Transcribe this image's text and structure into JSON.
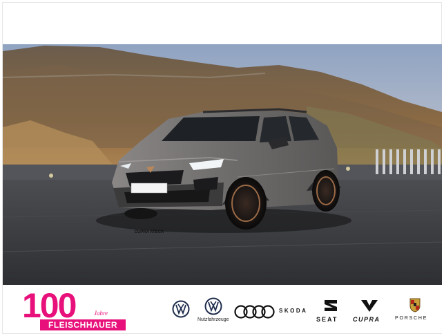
{
  "hero": {
    "plate_text": "CUPRA ATECA",
    "car_color": "#6f6d6c",
    "sky_color": "#a9b7cc",
    "ground_color": "#3a3b3e"
  },
  "footer": {
    "anniversary": {
      "number": "100",
      "jahre_text": "Jahre",
      "dealer_name": "FLEISCHHAUER",
      "brand_color": "#e8107a"
    },
    "brands": [
      {
        "id": "vw",
        "label": ""
      },
      {
        "id": "vw-nutzfahrzeuge",
        "label": "Nutzfahrzeuge"
      },
      {
        "id": "audi",
        "label": ""
      },
      {
        "id": "skoda",
        "label": "SKODA"
      },
      {
        "id": "seat",
        "label": "SEAT"
      },
      {
        "id": "cupra",
        "label": "CUPRA"
      },
      {
        "id": "porsche",
        "label": "PORSCHE"
      }
    ]
  }
}
